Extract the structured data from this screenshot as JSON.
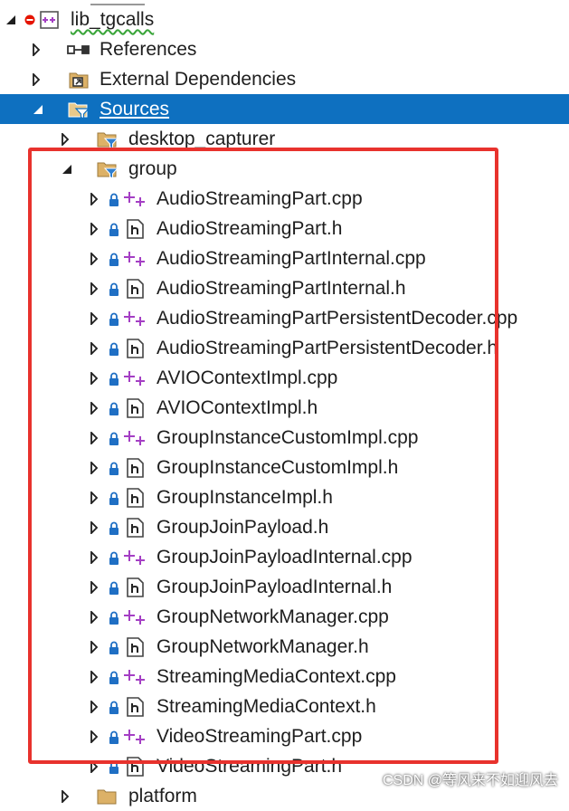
{
  "tree": {
    "project": {
      "label": "lib_tgcalls",
      "status": "error"
    },
    "references": {
      "label": "References"
    },
    "external_dependencies": {
      "label": "External Dependencies"
    },
    "sources": {
      "label": "Sources"
    },
    "desktop_capturer": {
      "label": "desktop_capturer"
    },
    "group": {
      "label": "group",
      "files": [
        {
          "name": "AudioStreamingPart.cpp",
          "kind": "cpp"
        },
        {
          "name": "AudioStreamingPart.h",
          "kind": "h"
        },
        {
          "name": "AudioStreamingPartInternal.cpp",
          "kind": "cpp"
        },
        {
          "name": "AudioStreamingPartInternal.h",
          "kind": "h"
        },
        {
          "name": "AudioStreamingPartPersistentDecoder.cpp",
          "kind": "cpp"
        },
        {
          "name": "AudioStreamingPartPersistentDecoder.h",
          "kind": "h"
        },
        {
          "name": "AVIOContextImpl.cpp",
          "kind": "cpp"
        },
        {
          "name": "AVIOContextImpl.h",
          "kind": "h"
        },
        {
          "name": "GroupInstanceCustomImpl.cpp",
          "kind": "cpp"
        },
        {
          "name": "GroupInstanceCustomImpl.h",
          "kind": "h"
        },
        {
          "name": "GroupInstanceImpl.h",
          "kind": "h"
        },
        {
          "name": "GroupJoinPayload.h",
          "kind": "h"
        },
        {
          "name": "GroupJoinPayloadInternal.cpp",
          "kind": "cpp"
        },
        {
          "name": "GroupJoinPayloadInternal.h",
          "kind": "h"
        },
        {
          "name": "GroupNetworkManager.cpp",
          "kind": "cpp"
        },
        {
          "name": "GroupNetworkManager.h",
          "kind": "h"
        },
        {
          "name": "StreamingMediaContext.cpp",
          "kind": "cpp"
        },
        {
          "name": "StreamingMediaContext.h",
          "kind": "h"
        },
        {
          "name": "VideoStreamingPart.cpp",
          "kind": "cpp"
        },
        {
          "name": "VideoStreamingPart.h",
          "kind": "h"
        }
      ]
    },
    "platform": {
      "label": "platform"
    }
  },
  "watermark": "CSDN @等风来不如迎风去",
  "colors": {
    "selection": "#0e70c0",
    "highlight_border": "#e8322d",
    "cpp_icon": "#a43fc4",
    "folder": "#dcb167",
    "lock": "#1f6fc4",
    "error": "#e51400"
  }
}
